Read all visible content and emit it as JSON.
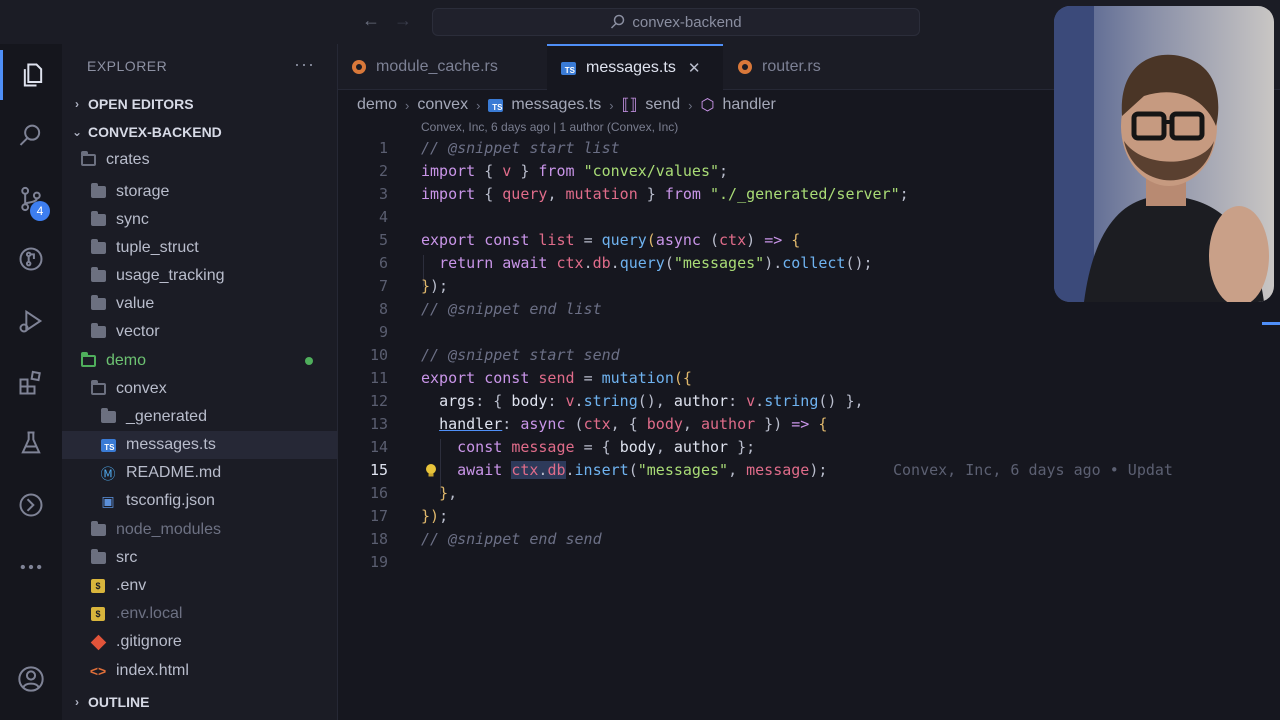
{
  "titlebar": {
    "search_text": "convex-backend"
  },
  "activity": {
    "scm_badge": "4"
  },
  "sidebar": {
    "header": "EXPLORER",
    "more": "···",
    "open_editors": "OPEN EDITORS",
    "workspace": "CONVEX-BACKEND",
    "outline": "OUTLINE",
    "tree": [
      {
        "label": "crates",
        "kind": "folder-open"
      },
      {
        "label": "storage",
        "kind": "folder"
      },
      {
        "label": "sync",
        "kind": "folder"
      },
      {
        "label": "tuple_struct",
        "kind": "folder"
      },
      {
        "label": "usage_tracking",
        "kind": "folder"
      },
      {
        "label": "value",
        "kind": "folder"
      },
      {
        "label": "vector",
        "kind": "folder"
      },
      {
        "label": "demo",
        "kind": "folder-open-green"
      },
      {
        "label": "convex",
        "kind": "folder-open"
      },
      {
        "label": "_generated",
        "kind": "folder"
      },
      {
        "label": "messages.ts",
        "kind": "ts"
      },
      {
        "label": "README.md",
        "kind": "md"
      },
      {
        "label": "tsconfig.json",
        "kind": "json"
      },
      {
        "label": "node_modules",
        "kind": "folder-dim"
      },
      {
        "label": "src",
        "kind": "folder"
      },
      {
        "label": ".env",
        "kind": "env"
      },
      {
        "label": ".env.local",
        "kind": "env-dim"
      },
      {
        "label": ".gitignore",
        "kind": "git"
      },
      {
        "label": "index.html",
        "kind": "html"
      }
    ]
  },
  "tabs": [
    {
      "label": "module_cache.rs"
    },
    {
      "label": "messages.ts",
      "close": "✕"
    },
    {
      "label": "router.rs"
    }
  ],
  "breadcrumb": [
    "demo",
    "convex",
    "messages.ts",
    "send",
    "handler"
  ],
  "blame_header": "Convex, Inc, 6 days ago | 1 author (Convex, Inc)",
  "blame_inline": "Convex, Inc, 6 days ago • Updat",
  "line_numbers": [
    "1",
    "2",
    "3",
    "4",
    "5",
    "6",
    "7",
    "8",
    "9",
    "10",
    "11",
    "12",
    "13",
    "14",
    "15",
    "16",
    "17",
    "18",
    "19"
  ],
  "code": {
    "l1": "// @snippet start list",
    "l8": "// @snippet end list",
    "l10": "// @snippet start send",
    "l18": "// @snippet end send",
    "str_values": "\"convex/values\"",
    "str_server": "\"./_generated/server\"",
    "str_messages": "\"messages\""
  }
}
